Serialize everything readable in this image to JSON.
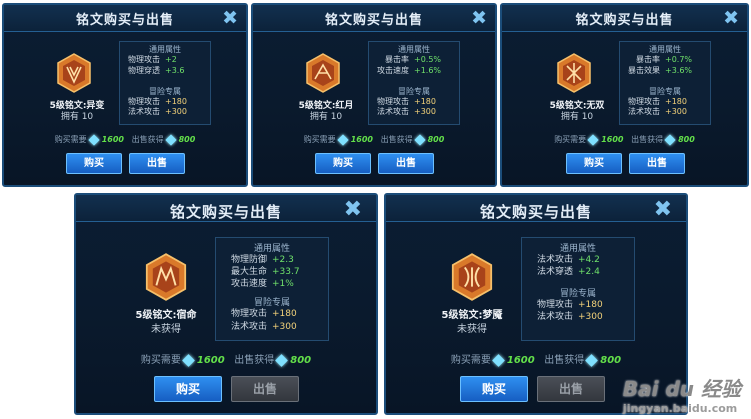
{
  "panels": [
    {
      "title": "铭文购买与出售",
      "rune_name": "5级铭文:异变",
      "status": "拥有 10",
      "common_header": "通用属性",
      "common_stats": [
        {
          "name": "物理攻击",
          "value": "+2"
        },
        {
          "name": "物理穿透",
          "value": "+3.6"
        }
      ],
      "adventure_header": "冒险专属",
      "adventure_stats": [
        {
          "name": "物理攻击",
          "value": "+180"
        },
        {
          "name": "法术攻击",
          "value": "+300"
        }
      ],
      "buy_label": "购买需要",
      "buy_price": "1600",
      "sell_label": "出售获得",
      "sell_price": "800",
      "buy_button": "购买",
      "sell_button": "出售",
      "sell_enabled": true
    },
    {
      "title": "铭文购买与出售",
      "rune_name": "5级铭文:红月",
      "status": "拥有 10",
      "common_header": "通用属性",
      "common_stats": [
        {
          "name": "暴击率",
          "value": "+0.5%"
        },
        {
          "name": "攻击速度",
          "value": "+1.6%"
        }
      ],
      "adventure_header": "冒险专属",
      "adventure_stats": [
        {
          "name": "物理攻击",
          "value": "+180"
        },
        {
          "name": "法术攻击",
          "value": "+300"
        }
      ],
      "buy_label": "购买需要",
      "buy_price": "1600",
      "sell_label": "出售获得",
      "sell_price": "800",
      "buy_button": "购买",
      "sell_button": "出售",
      "sell_enabled": true
    },
    {
      "title": "铭文购买与出售",
      "rune_name": "5级铭文:无双",
      "status": "拥有 10",
      "common_header": "通用属性",
      "common_stats": [
        {
          "name": "暴击率",
          "value": "+0.7%"
        },
        {
          "name": "暴击效果",
          "value": "+3.6%"
        }
      ],
      "adventure_header": "冒险专属",
      "adventure_stats": [
        {
          "name": "物理攻击",
          "value": "+180"
        },
        {
          "name": "法术攻击",
          "value": "+300"
        }
      ],
      "buy_label": "购买需要",
      "buy_price": "1600",
      "sell_label": "出售获得",
      "sell_price": "800",
      "buy_button": "购买",
      "sell_button": "出售",
      "sell_enabled": true
    },
    {
      "title": "铭文购买与出售",
      "rune_name": "5级铭文:宿命",
      "status": "未获得",
      "common_header": "通用属性",
      "common_stats": [
        {
          "name": "物理防御",
          "value": "+2.3"
        },
        {
          "name": "最大生命",
          "value": "+33.7"
        },
        {
          "name": "攻击速度",
          "value": "+1%"
        }
      ],
      "adventure_header": "冒险专属",
      "adventure_stats": [
        {
          "name": "物理攻击",
          "value": "+180"
        },
        {
          "name": "法术攻击",
          "value": "+300"
        }
      ],
      "buy_label": "购买需要",
      "buy_price": "1600",
      "sell_label": "出售获得",
      "sell_price": "800",
      "buy_button": "购买",
      "sell_button": "出售",
      "sell_enabled": false
    },
    {
      "title": "铭文购买与出售",
      "rune_name": "5级铭文:梦魇",
      "status": "未获得",
      "common_header": "通用属性",
      "common_stats": [
        {
          "name": "法术攻击",
          "value": "+4.2"
        },
        {
          "name": "法术穿透",
          "value": "+2.4"
        }
      ],
      "adventure_header": "冒险专属",
      "adventure_stats": [
        {
          "name": "物理攻击",
          "value": "+180"
        },
        {
          "name": "法术攻击",
          "value": "+300"
        }
      ],
      "buy_label": "购买需要",
      "buy_price": "1600",
      "sell_label": "出售获得",
      "sell_price": "800",
      "buy_button": "购买",
      "sell_button": "出售",
      "sell_enabled": false
    }
  ],
  "watermark": {
    "brand": "Bai du 经验",
    "url": "jingyan.baidu.com"
  },
  "colors": {
    "panel_bg": "#0b1d33",
    "panel_border": "#1b4d7a",
    "stat_value": "#6fe06a",
    "adventure_value": "#f3d27a",
    "price": "#63e04a",
    "button_blue": "#2f8ff0",
    "button_disabled": "#4a4f57",
    "rune_orange": "#d9792a"
  },
  "icons": {
    "close": "close-x-icon",
    "rune": "rune-hexagon-icon",
    "currency": "crystal-gem-icon"
  }
}
